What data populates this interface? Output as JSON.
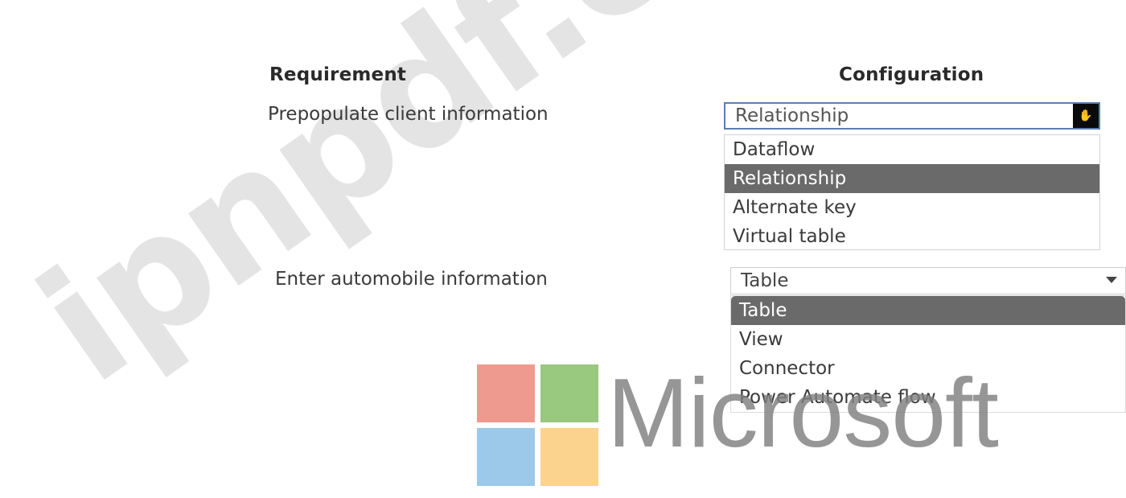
{
  "headers": {
    "requirement": "Requirement",
    "configuration": "Configuration"
  },
  "rows": [
    {
      "requirement": "Prepopulate client information",
      "selected": "Relationship",
      "options": [
        "Dataflow",
        "Relationship",
        "Alternate key",
        "Virtual table"
      ]
    },
    {
      "requirement": "Enter automobile information",
      "selected": "Table",
      "options": [
        "Table",
        "View",
        "Connector",
        "Power Automate flow"
      ]
    }
  ],
  "logo": {
    "wordmark": "Microsoft",
    "colors": [
      "#ef9a8e",
      "#99c87f",
      "#9cc8e9",
      "#fbd28e"
    ]
  },
  "watermark": "ipnpdf.com",
  "icons": {
    "dropdown1": "cursor-hand-icon",
    "dropdown2": "chevron-down-icon"
  }
}
